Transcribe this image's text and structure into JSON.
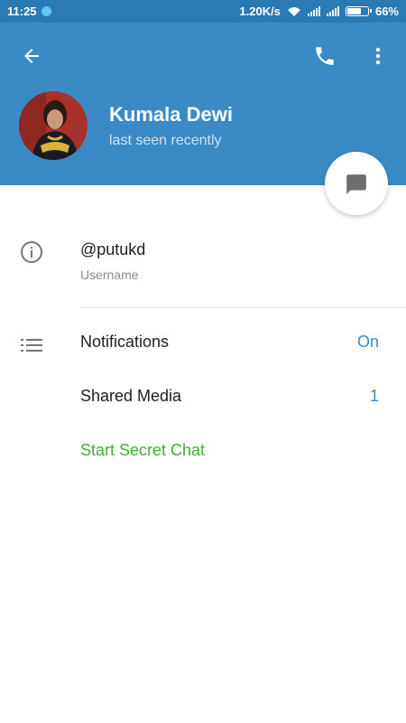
{
  "status_bar": {
    "time": "11:25",
    "network_speed": "1.20K/s",
    "battery": "66%",
    "icons": [
      "app-notification-icon",
      "wifi-icon",
      "signal-icon",
      "signal-icon",
      "battery-icon"
    ]
  },
  "header": {
    "back_icon": "arrow-left-icon",
    "call_icon": "phone-icon",
    "more_icon": "more-vertical-icon",
    "name": "Kumala Dewi",
    "status": "last seen recently",
    "colors": {
      "background": "#3a8bc5",
      "statusbar": "#2a7ab5"
    }
  },
  "fab": {
    "icon": "message-icon"
  },
  "info": {
    "icon": "info-icon",
    "username": "@putukd",
    "username_label": "Username"
  },
  "settings": {
    "icon": "list-icon",
    "notifications": {
      "label": "Notifications",
      "value": "On"
    },
    "shared_media": {
      "label": "Shared Media",
      "value": "1"
    },
    "secret_chat": {
      "label": "Start Secret Chat",
      "color": "#3cb22d"
    },
    "accent": "#3a8bc5"
  }
}
